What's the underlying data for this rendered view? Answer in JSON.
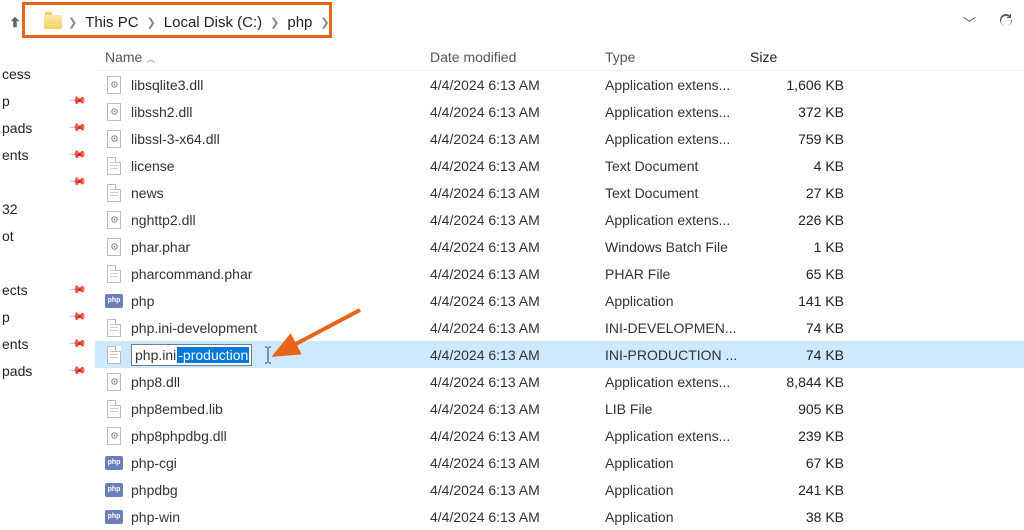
{
  "annotation_color": "#e8641b",
  "breadcrumb": {
    "items": [
      "This PC",
      "Local Disk (C:)",
      "php"
    ]
  },
  "nav": {
    "items": [
      {
        "label": "cess",
        "pinned": false
      },
      {
        "label": "p",
        "pinned": true
      },
      {
        "label": "pads",
        "pinned": true
      },
      {
        "label": "ents",
        "pinned": true
      },
      {
        "label": "",
        "pinned": true
      },
      {
        "label": "32",
        "pinned": false
      },
      {
        "label": "ot",
        "pinned": false
      },
      {
        "label": "",
        "pinned": false
      },
      {
        "label": "ects",
        "pinned": true
      },
      {
        "label": "p",
        "pinned": true
      },
      {
        "label": "ents",
        "pinned": true
      },
      {
        "label": "pads",
        "pinned": true
      }
    ]
  },
  "columns": {
    "name": "Name",
    "modified": "Date modified",
    "type": "Type",
    "size": "Size"
  },
  "rename": {
    "prefix": "php.ini",
    "selected": "-production"
  },
  "files": [
    {
      "icon": "gear",
      "name": "libsqlite3.dll",
      "modified": "4/4/2024 6:13 AM",
      "type": "Application extens...",
      "size": "1,606 KB"
    },
    {
      "icon": "gear",
      "name": "libssh2.dll",
      "modified": "4/4/2024 6:13 AM",
      "type": "Application extens...",
      "size": "372 KB"
    },
    {
      "icon": "gear",
      "name": "libssl-3-x64.dll",
      "modified": "4/4/2024 6:13 AM",
      "type": "Application extens...",
      "size": "759 KB"
    },
    {
      "icon": "page",
      "name": "license",
      "modified": "4/4/2024 6:13 AM",
      "type": "Text Document",
      "size": "4 KB"
    },
    {
      "icon": "page",
      "name": "news",
      "modified": "4/4/2024 6:13 AM",
      "type": "Text Document",
      "size": "27 KB"
    },
    {
      "icon": "gear",
      "name": "nghttp2.dll",
      "modified": "4/4/2024 6:13 AM",
      "type": "Application extens...",
      "size": "226 KB"
    },
    {
      "icon": "gear",
      "name": "phar.phar",
      "modified": "4/4/2024 6:13 AM",
      "type": "Windows Batch File",
      "size": "1 KB"
    },
    {
      "icon": "page",
      "name": "pharcommand.phar",
      "modified": "4/4/2024 6:13 AM",
      "type": "PHAR File",
      "size": "65 KB"
    },
    {
      "icon": "php",
      "name": "php",
      "modified": "4/4/2024 6:13 AM",
      "type": "Application",
      "size": "141 KB"
    },
    {
      "icon": "page",
      "name": "php.ini-development",
      "modified": "4/4/2024 6:13 AM",
      "type": "INI-DEVELOPMEN...",
      "size": "74 KB"
    },
    {
      "icon": "page",
      "name": "__RENAME__",
      "modified": "4/4/2024 6:13 AM",
      "type": "INI-PRODUCTION ...",
      "size": "74 KB",
      "selected": true,
      "rename": true
    },
    {
      "icon": "gear",
      "name": "php8.dll",
      "modified": "4/4/2024 6:13 AM",
      "type": "Application extens...",
      "size": "8,844 KB"
    },
    {
      "icon": "page",
      "name": "php8embed.lib",
      "modified": "4/4/2024 6:13 AM",
      "type": "LIB File",
      "size": "905 KB"
    },
    {
      "icon": "gear",
      "name": "php8phpdbg.dll",
      "modified": "4/4/2024 6:13 AM",
      "type": "Application extens...",
      "size": "239 KB"
    },
    {
      "icon": "php",
      "name": "php-cgi",
      "modified": "4/4/2024 6:13 AM",
      "type": "Application",
      "size": "67 KB"
    },
    {
      "icon": "php",
      "name": "phpdbg",
      "modified": "4/4/2024 6:13 AM",
      "type": "Application",
      "size": "241 KB"
    },
    {
      "icon": "php",
      "name": "php-win",
      "modified": "4/4/2024 6:13 AM",
      "type": "Application",
      "size": "38 KB"
    }
  ]
}
